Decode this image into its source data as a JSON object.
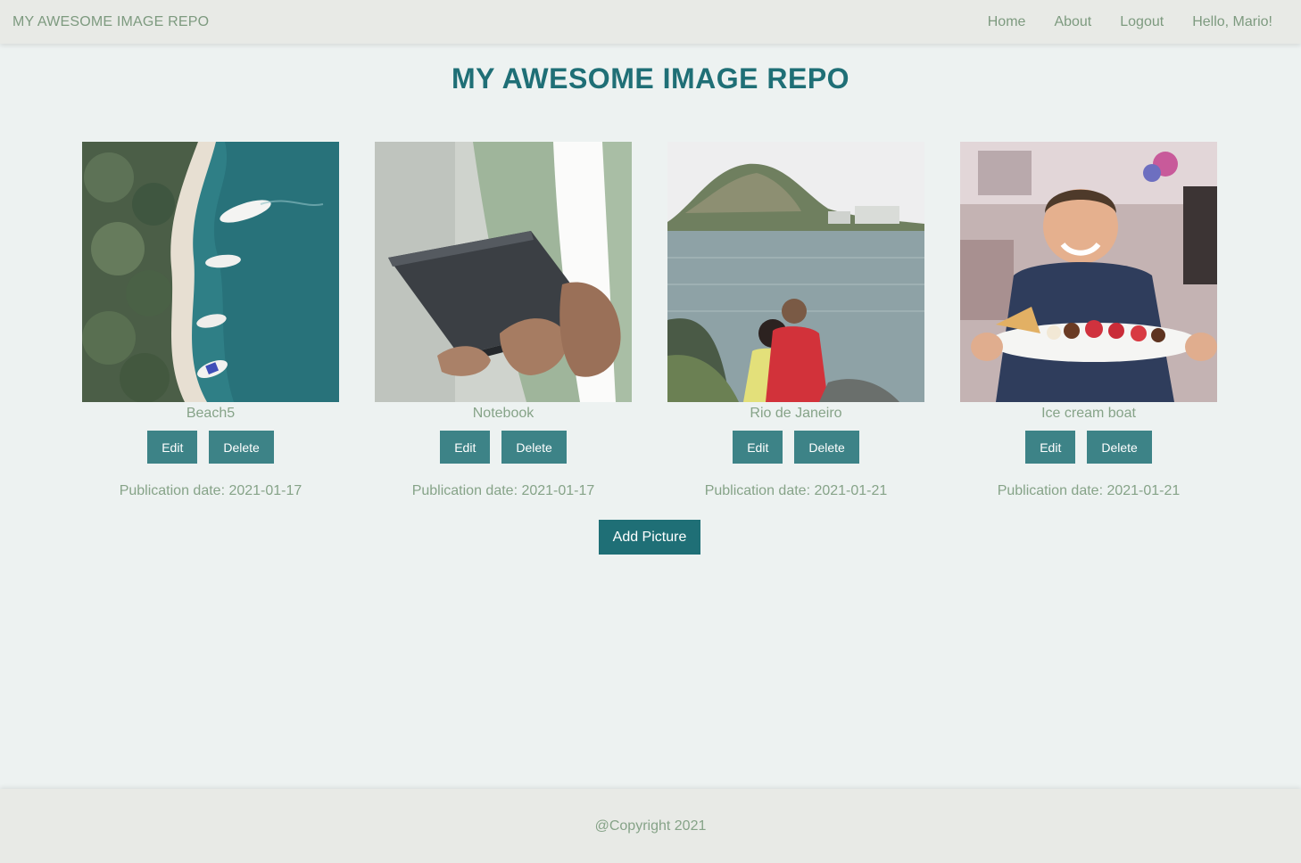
{
  "nav": {
    "brand": "MY AWESOME IMAGE REPO",
    "links": [
      "Home",
      "About",
      "Logout",
      "Hello, Mario!"
    ]
  },
  "page": {
    "title": "MY AWESOME IMAGE REPO"
  },
  "gallery": {
    "items": [
      {
        "caption": "Beach5",
        "edit_label": "Edit",
        "delete_label": "Delete",
        "date": "Publication date: 2021-01-17"
      },
      {
        "caption": "Notebook",
        "edit_label": "Edit",
        "delete_label": "Delete",
        "date": "Publication date: 2021-01-17"
      },
      {
        "caption": "Rio de Janeiro",
        "edit_label": "Edit",
        "delete_label": "Delete",
        "date": "Publication date: 2021-01-21"
      },
      {
        "caption": "Ice cream boat",
        "edit_label": "Edit",
        "delete_label": "Delete",
        "date": "Publication date: 2021-01-21"
      }
    ],
    "add_label": "Add Picture"
  },
  "footer": {
    "copyright": "@Copyright 2021"
  },
  "colors": {
    "page_bg": "#edf2f1",
    "bar_bg": "#e8eae6",
    "title": "#1f6f76",
    "button": "#3d8387",
    "add_button": "#1f6f76",
    "muted_text": "#86a388"
  }
}
